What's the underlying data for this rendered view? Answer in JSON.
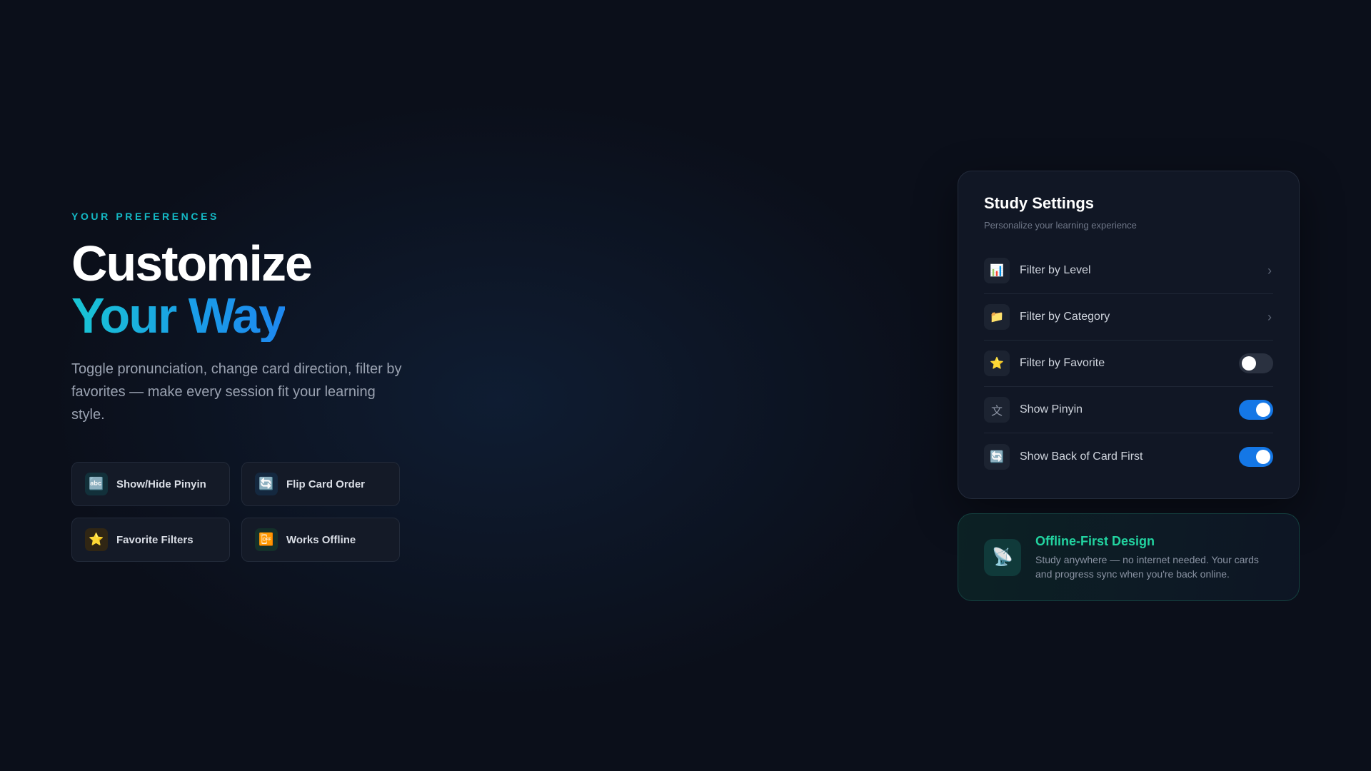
{
  "hero": {
    "eyebrow": "YOUR PREFERENCES",
    "title_line1": "Customize",
    "title_line2": "Your Way",
    "description": "Toggle pronunciation, change card direction, filter by favorites — make every session fit your learning style.",
    "accent_color": "#19c6d3"
  },
  "features": [
    {
      "icon": "abc-icon",
      "glyph": "🔤",
      "label": "Show/Hide Pinyin"
    },
    {
      "icon": "flip-icon",
      "glyph": "🔄",
      "label": "Flip Card Order"
    },
    {
      "icon": "star-icon",
      "glyph": "⭐",
      "label": "Favorite Filters"
    },
    {
      "icon": "offline-icon",
      "glyph": "📴",
      "label": "Works Offline"
    }
  ],
  "settings": {
    "title": "Study Settings",
    "subtitle": "Personalize your learning experience",
    "items": [
      {
        "icon": "bar-chart-icon",
        "glyph": "📊",
        "label": "Filter by Level",
        "control": "chevron",
        "chevron": "›"
      },
      {
        "icon": "folder-icon",
        "glyph": "📁",
        "label": "Filter by Category",
        "control": "chevron",
        "chevron": "›"
      },
      {
        "icon": "star-icon",
        "glyph": "⭐",
        "label": "Filter by Favorite",
        "control": "toggle",
        "on": false
      },
      {
        "icon": "chinese-character-icon",
        "glyph": "文",
        "label": "Show Pinyin",
        "control": "toggle",
        "on": true
      },
      {
        "icon": "flip-icon",
        "glyph": "🔄",
        "label": "Show Back of Card First",
        "control": "toggle",
        "on": true
      }
    ],
    "toggle_on_color": "#1477e6"
  },
  "offline": {
    "icon": "satellite-antenna-icon",
    "glyph": "📡",
    "title": "Offline-First Design",
    "text": "Study anywhere — no internet needed. Your cards and progress sync when you're back online.",
    "accent_color": "#22d3a0"
  }
}
